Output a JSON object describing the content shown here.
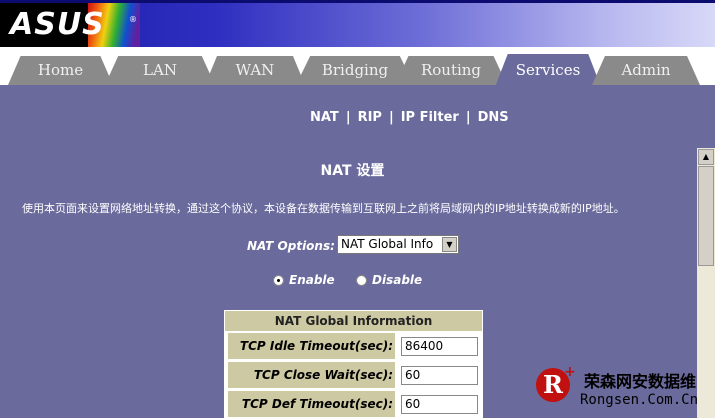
{
  "header": {
    "logo": "ASUS",
    "logo_mark": "®"
  },
  "tabs": [
    {
      "label": "Home"
    },
    {
      "label": "LAN"
    },
    {
      "label": "WAN"
    },
    {
      "label": "Bridging"
    },
    {
      "label": "Routing"
    },
    {
      "label": "Services",
      "active": true
    },
    {
      "label": "Admin"
    }
  ],
  "subnav": [
    "NAT",
    "RIP",
    "IP Filter",
    "DNS"
  ],
  "page": {
    "title": "NAT 设置",
    "description": "使用本页面来设置网络地址转换，通过这个协议，本设备在数据传输到互联网上之前将局域网内的IP地址转换成新的IP地址。"
  },
  "nat_options": {
    "label": "NAT Options:",
    "selected": "NAT Global Info"
  },
  "mode": {
    "enable_label": "Enable",
    "disable_label": "Disable",
    "selected": "Enable"
  },
  "table": {
    "header": "NAT Global Information",
    "rows": [
      {
        "label": "TCP Idle Timeout(sec):",
        "value": "86400"
      },
      {
        "label": "TCP Close Wait(sec):",
        "value": "60"
      },
      {
        "label": "TCP Def Timeout(sec):",
        "value": "60"
      }
    ]
  },
  "watermark": {
    "mark": "R",
    "cn": "荣森网安数据维",
    "en": "Rongsen.Com.Cn"
  },
  "colors": {
    "background": "#6a6a9c",
    "table_label": "#cdc9a3",
    "tab_inactive": "#8a8a8a"
  }
}
